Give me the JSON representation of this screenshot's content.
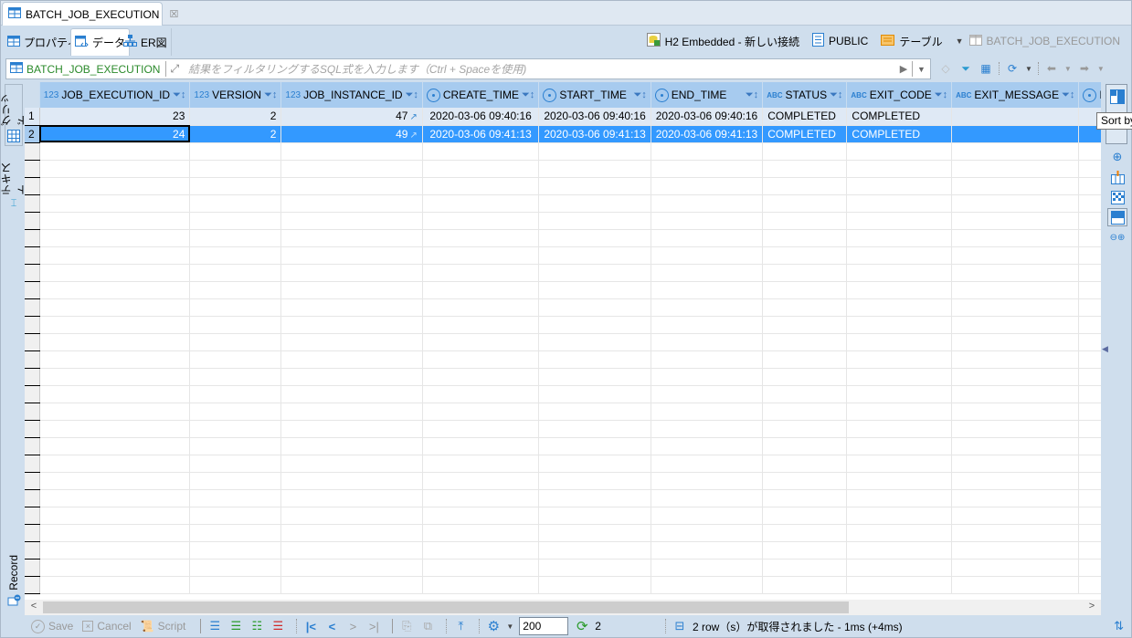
{
  "editor_tab": {
    "title": "BATCH_JOB_EXECUTION",
    "close_glyph": "☒"
  },
  "subtabs": [
    {
      "label": "プロパティ",
      "icon": "table-icon"
    },
    {
      "label": "データ",
      "icon": "data-icon",
      "active": true
    },
    {
      "label": "ER図",
      "icon": "er-diagram-icon"
    }
  ],
  "breadcrumb": {
    "connection": "H2 Embedded - 新しい接続",
    "schema": "PUBLIC",
    "folder": "テーブル",
    "table": "BATCH_JOB_EXECUTION"
  },
  "filter": {
    "table_name": "BATCH_JOB_EXECUTION",
    "placeholder": "結果をフィルタリングするSQL式を入力します（Ctrl + Spaceを使用)",
    "value": ""
  },
  "left_tabs": {
    "grid": "グリッド",
    "text": "テキスト",
    "record": "Record"
  },
  "columns": [
    {
      "name": "JOB_EXECUTION_ID",
      "type": "123"
    },
    {
      "name": "VERSION",
      "type": "123"
    },
    {
      "name": "JOB_INSTANCE_ID",
      "type": "123"
    },
    {
      "name": "CREATE_TIME",
      "type": "datetime"
    },
    {
      "name": "START_TIME",
      "type": "datetime"
    },
    {
      "name": "END_TIME",
      "type": "datetime"
    },
    {
      "name": "STATUS",
      "type": "ABC"
    },
    {
      "name": "EXIT_CODE",
      "type": "ABC"
    },
    {
      "name": "EXIT_MESSAGE",
      "type": "ABC"
    },
    {
      "name": "L",
      "type": "datetime"
    }
  ],
  "rows": [
    {
      "num": "1",
      "JOB_EXECUTION_ID": "23",
      "VERSION": "2",
      "JOB_INSTANCE_ID": "47",
      "CREATE_TIME": "2020-03-06 09:40:16",
      "START_TIME": "2020-03-06 09:40:16",
      "END_TIME": "2020-03-06 09:40:16",
      "STATUS": "COMPLETED",
      "EXIT_CODE": "COMPLETED",
      "EXIT_MESSAGE": ""
    },
    {
      "num": "2",
      "JOB_EXECUTION_ID": "24",
      "VERSION": "2",
      "JOB_INSTANCE_ID": "49",
      "CREATE_TIME": "2020-03-06 09:41:13",
      "START_TIME": "2020-03-06 09:41:13",
      "END_TIME": "2020-03-06 09:41:13",
      "STATUS": "COMPLETED",
      "EXIT_CODE": "COMPLETED",
      "EXIT_MESSAGE": ""
    }
  ],
  "selected_row": 2,
  "tooltip": "Sort by",
  "bottom": {
    "save": "Save",
    "cancel": "Cancel",
    "script": "Script",
    "fetch_size": "200",
    "refresh_count": "2",
    "status": "2 row（s）が取得されました - 1ms (+4ms)"
  },
  "colors": {
    "header_bg": "#a7cbef",
    "selection": "#3399ff",
    "panel_bg": "#cfdeed",
    "table_name_green": "#2b8a2b"
  }
}
